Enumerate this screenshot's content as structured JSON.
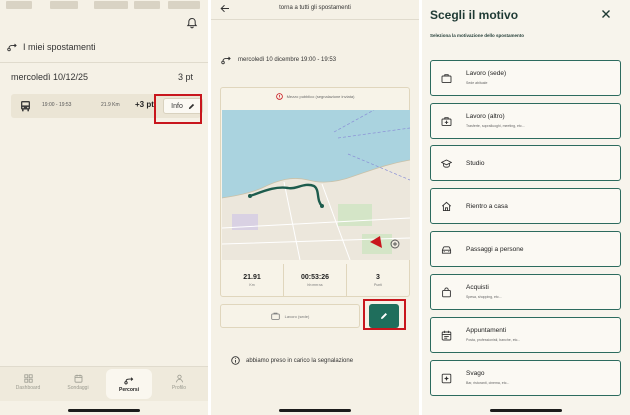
{
  "screen1": {
    "section_title": "I miei spostamenti",
    "day_label": "mercoledì 10/12/25",
    "day_points": "3 pt",
    "trip": {
      "time": "19:00 - 19:53",
      "distance": "21.9 Km",
      "points": "+3 pt",
      "info_label": "Info"
    },
    "tabs": [
      {
        "label": "Dashboard",
        "icon": "dashboard-icon"
      },
      {
        "label": "Sondaggi",
        "icon": "calendar-icon"
      },
      {
        "label": "Percorsi",
        "icon": "route-icon",
        "active": true
      },
      {
        "label": "Profilo",
        "icon": "profile-icon"
      }
    ]
  },
  "screen2": {
    "header": "torna a tutti gli spostamenti",
    "route_title": "mercoledì 10 dicembre 19:00 - 19:53",
    "notice": "Mezzo pubblico (segnalazione inviata)",
    "stats": [
      {
        "value": "21.91",
        "unit": "Km"
      },
      {
        "value": "00:53:26",
        "unit": "hh:mm:ss"
      },
      {
        "value": "3",
        "unit": "Punti"
      }
    ],
    "reason_label": "Lavoro (sede)",
    "ack_text": "abbiamo preso in carico la segnalazione"
  },
  "screen3": {
    "title": "Scegli il motivo",
    "subtitle": "Seleziona la motivazione dello spostamento",
    "options": [
      {
        "title": "Lavoro (sede)",
        "desc": "Sede abituale",
        "icon": "briefcase-icon"
      },
      {
        "title": "Lavoro (altro)",
        "desc": "Trasferte, sopralluoghi, meeting, etc...",
        "icon": "briefcase-plus-icon"
      },
      {
        "title": "Studio",
        "desc": "",
        "icon": "graduation-cap-icon"
      },
      {
        "title": "Rientro a casa",
        "desc": "",
        "icon": "home-icon"
      },
      {
        "title": "Passaggi a persone",
        "desc": "",
        "icon": "car-icon"
      },
      {
        "title": "Acquisti",
        "desc": "Spesa, shopping, etc...",
        "icon": "shopping-bag-icon"
      },
      {
        "title": "Appuntamenti",
        "desc": "Posta, professionisti, banche, etc...",
        "icon": "calendar-icon"
      },
      {
        "title": "Svago",
        "desc": "Bar, ristoranti, cinema, etc...",
        "icon": "sparkle-icon"
      }
    ]
  },
  "colors": {
    "primary_green": "#1f6e5c",
    "highlight_red": "#c8161d",
    "background_cream": "#f5f1e6"
  }
}
